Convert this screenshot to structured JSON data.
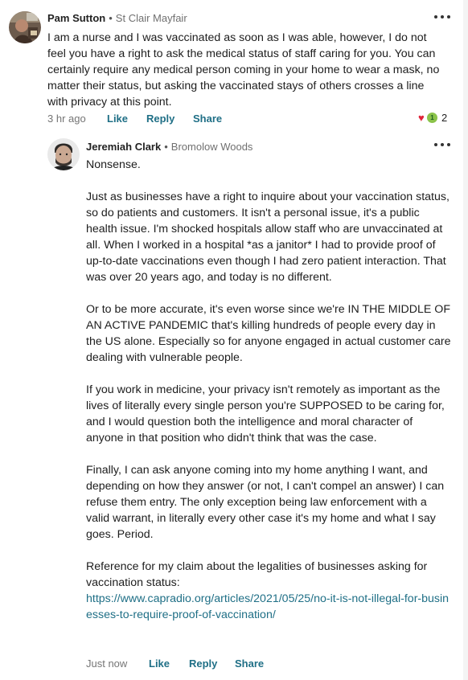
{
  "comments": [
    {
      "author": "Pam Sutton",
      "separator": "•",
      "neighborhood": "St Clair Mayfair",
      "text": "I am a nurse and I was vaccinated as soon as I was able, however, I do not feel you have a right to ask the medical status of staff caring for you. You can certainly require any medical person coming in your home to wear a mask, no matter their status, but asking the vaccinated stays of others crosses a line with privacy at this point.",
      "time": "3 hr ago",
      "like_label": "Like",
      "reply_label": "Reply",
      "share_label": "Share",
      "reactions": {
        "heart_icon": "heart-icon",
        "badge_icon": "neighbor-badge-icon",
        "badge_glyph": "1",
        "count": "2"
      }
    }
  ],
  "reply": {
    "author": "Jeremiah Clark",
    "separator": "•",
    "neighborhood": "Bromolow Woods",
    "paragraphs": [
      "Nonsense.",
      "Just as businesses have a right to inquire about your vaccination status, so do patients and customers. It isn't a personal issue, it's a public health issue. I'm shocked hospitals allow staff who are unvaccinated at all. When I worked in a hospital *as a janitor* I had to provide proof of up-to-date vaccinations even though I had zero patient interaction. That was over 20 years ago, and today is no different.",
      "Or to be more accurate, it's even worse since we're IN THE MIDDLE OF AN ACTIVE PANDEMIC that's killing hundreds of people every day in the US alone. Especially so for anyone engaged in actual customer care dealing with vulnerable people.",
      "If you work in medicine, your privacy isn't remotely as important as the lives of literally every single person you're SUPPOSED to be caring for, and I would question both the intelligence and moral character of anyone in that position who didn't think that was the case.",
      "Finally, I can ask anyone coming into my home anything I want, and depending on how they answer (or not, I can't compel an answer) I can refuse them entry. The only exception being law enforcement with a valid warrant, in literally every other case it's my home and what I say goes. Period.",
      "Reference for my claim about the legalities of businesses asking for vaccination status:"
    ],
    "link": "https://www.capradio.org/articles/2021/05/25/no-it-is-not-illegal-for-businesses-to-require-proof-of-vaccination/",
    "time": "Just now",
    "like_label": "Like",
    "reply_label": "Reply",
    "share_label": "Share"
  },
  "icons": {
    "more": "more-options-icon",
    "avatar1": "avatar-pam-sutton",
    "avatar2": "avatar-jeremiah-clark"
  },
  "colors": {
    "action": "#1f6f86",
    "link": "#1f6f86",
    "muted": "#757575",
    "heart": "#e0243a",
    "badge": "#8bc34a"
  }
}
